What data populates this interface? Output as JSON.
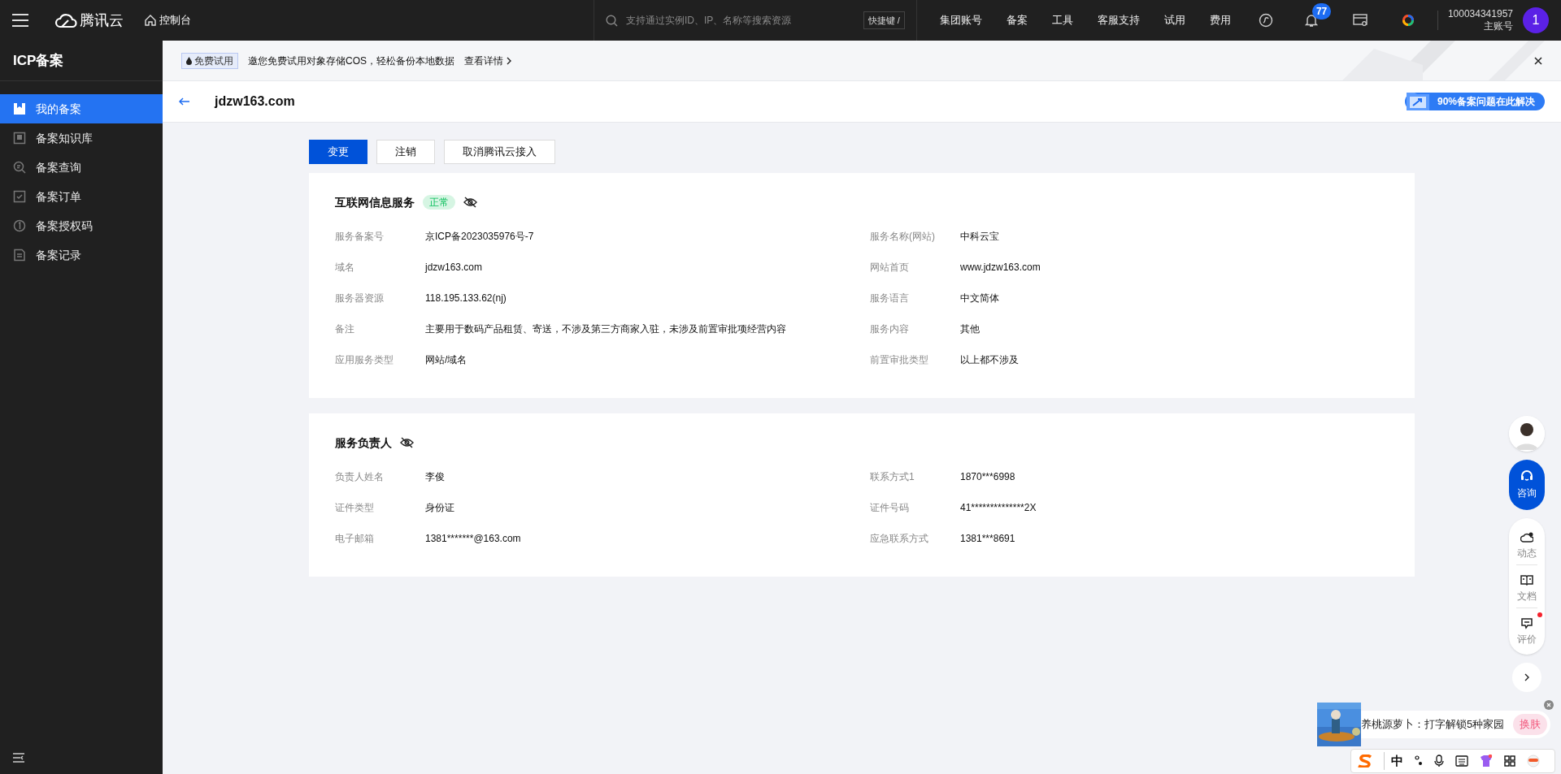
{
  "topbar": {
    "brand": "腾讯云",
    "console": "控制台",
    "search_placeholder": "支持通过实例ID、IP、名称等搜索资源",
    "shortcut": "快捷键 /",
    "nav": [
      "集团账号",
      "备案",
      "工具",
      "客服支持",
      "试用",
      "费用"
    ],
    "notification_count": "77",
    "account_id": "100034341957",
    "account_role": "主账号",
    "avatar_letter": "1"
  },
  "sidebar": {
    "title": "ICP备案",
    "items": [
      {
        "label": "我的备案",
        "selected": true
      },
      {
        "label": "备案知识库",
        "selected": false
      },
      {
        "label": "备案查询",
        "selected": false
      },
      {
        "label": "备案订单",
        "selected": false
      },
      {
        "label": "备案授权码",
        "selected": false
      },
      {
        "label": "备案记录",
        "selected": false
      }
    ]
  },
  "banner": {
    "tag": "免费试用",
    "text": "邀您免费试用对象存储COS，轻松备份本地数据",
    "link": "查看详情"
  },
  "header": {
    "title": "jdzw163.com",
    "help": "90%备案问题在此解决"
  },
  "actions": [
    {
      "label": "变更",
      "kind": "primary"
    },
    {
      "label": "注销",
      "kind": "default"
    },
    {
      "label": "取消腾讯云接入",
      "kind": "default"
    }
  ],
  "sections": [
    {
      "title": "互联网信息服务",
      "status": "正常",
      "fields": [
        {
          "label": "服务备案号",
          "value": "京ICP备2023035976号-7"
        },
        {
          "label": "服务名称(网站)",
          "value": "中科云宝"
        },
        {
          "label": "域名",
          "value": "jdzw163.com"
        },
        {
          "label": "网站首页",
          "value": "www.jdzw163.com"
        },
        {
          "label": "服务器资源",
          "value": "118.195.133.62(nj)"
        },
        {
          "label": "服务语言",
          "value": "中文简体"
        },
        {
          "label": "备注",
          "value": "主要用于数码产品租赁、寄送，不涉及第三方商家入驻，未涉及前置审批项经营内容"
        },
        {
          "label": "服务内容",
          "value": "其他"
        },
        {
          "label": "应用服务类型",
          "value": "网站/域名"
        },
        {
          "label": "前置审批类型",
          "value": "以上都不涉及"
        }
      ]
    },
    {
      "title": "服务负责人",
      "fields": [
        {
          "label": "负责人姓名",
          "value": "李俊"
        },
        {
          "label": "联系方式1",
          "value": "1870***6998"
        },
        {
          "label": "证件类型",
          "value": "身份证"
        },
        {
          "label": "证件号码",
          "value": "41**************2X"
        },
        {
          "label": "电子邮箱",
          "value": "1381*******@163.com"
        },
        {
          "label": "应急联系方式",
          "value": "1381***8691"
        }
      ]
    }
  ],
  "float": {
    "consult": "咨询",
    "tools": [
      {
        "label": "动态",
        "dot": false
      },
      {
        "label": "文档",
        "dot": false
      },
      {
        "label": "评价",
        "dot": true
      }
    ]
  },
  "ime_popup": {
    "text": "养桃源萝卜：打字解锁5种家园",
    "button": "换肤"
  },
  "ime_toolbar": {
    "mode": "中"
  }
}
